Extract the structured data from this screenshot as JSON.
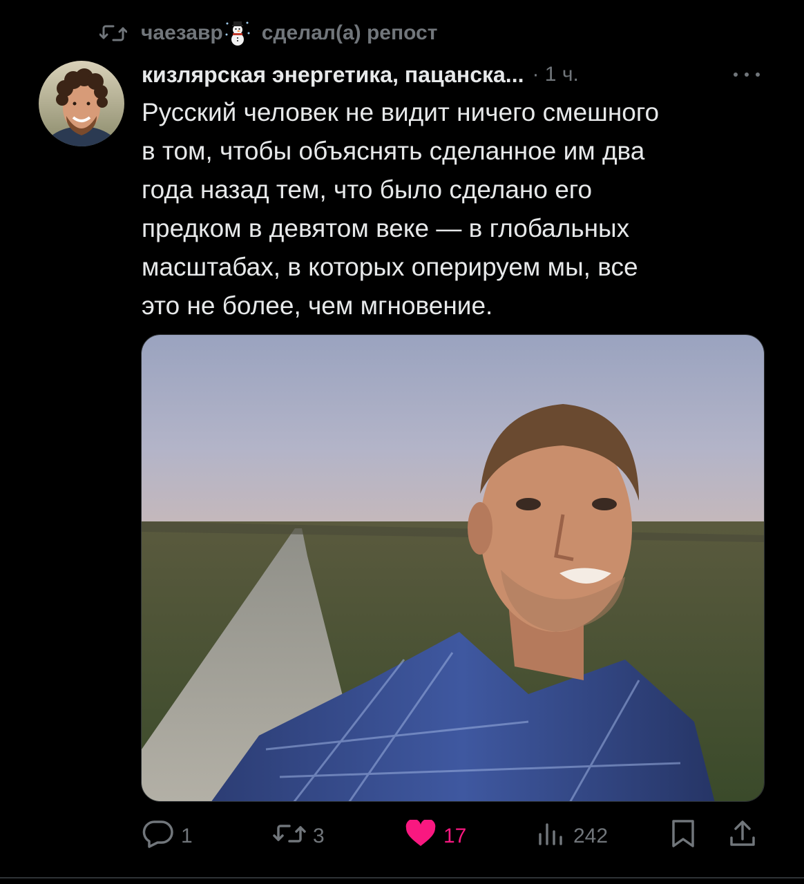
{
  "repost": {
    "icon": "repost-icon",
    "user": "чаезавр",
    "emoji": "snowman-icon",
    "label": "сделал(а) репост"
  },
  "post": {
    "author": "кизлярская энергетика, пацанска...",
    "time": "· 1 ч.",
    "text": "Русский человек не видит ничего смешного\nв том, чтобы объяснять сделанное им два\nгода назад тем, что было сделано его\nпредком в девятом веке — в глобальных\nмасштабах, в которых оперируем мы,  все\nэто не более, чем мгновение.",
    "more_icon": "more-dots-icon"
  },
  "actions": {
    "replies": "1",
    "reposts": "3",
    "likes": "17",
    "views": "242"
  },
  "colors": {
    "background": "#000000",
    "text": "#e7e9ea",
    "muted": "#71767b",
    "like": "#f91880"
  }
}
